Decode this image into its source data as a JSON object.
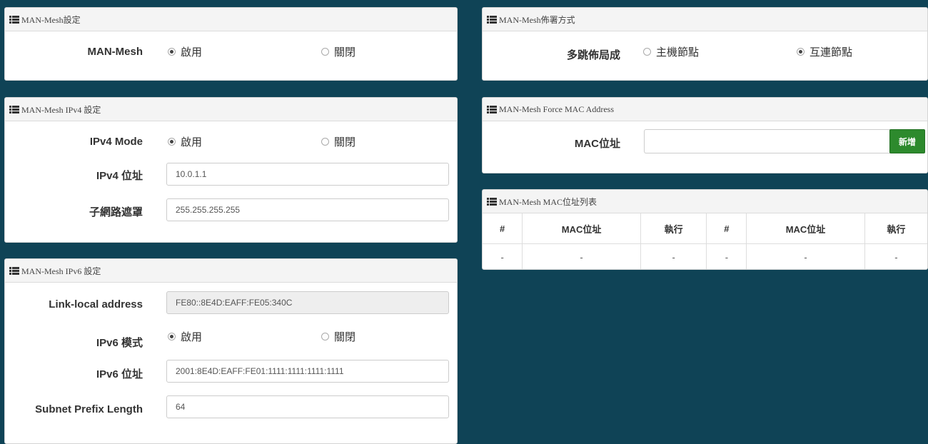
{
  "mesh_settings": {
    "title": "MAN-Mesh設定",
    "label": "MAN-Mesh",
    "options": [
      "啟用",
      "關閉"
    ],
    "selected": "啟用"
  },
  "deploy_mode": {
    "title": "MAN-Mesh佈署方式",
    "label": "多跳佈局成",
    "options": [
      "主機節點",
      "互連節點"
    ],
    "selected": "互連節點"
  },
  "ipv4": {
    "title": "MAN-Mesh IPv4 設定",
    "mode_label": "IPv4 Mode",
    "options": [
      "啟用",
      "關閉"
    ],
    "selected": "啟用",
    "address_label": "IPv4 位址",
    "address_value": "10.0.1.1",
    "netmask_label": "子網路遮罩",
    "netmask_value": "255.255.255.255"
  },
  "force_mac": {
    "title": "MAN-Mesh Force MAC Address",
    "label": "MAC位址",
    "value": "",
    "add_button": "新增"
  },
  "mac_list": {
    "title": "MAN-Mesh MAC位址列表",
    "headers": [
      "#",
      "MAC位址",
      "執行",
      "#",
      "MAC位址",
      "執行"
    ],
    "rows": [
      [
        "-",
        "-",
        "-",
        "-",
        "-",
        "-"
      ]
    ]
  },
  "ipv6": {
    "title": "MAN-Mesh IPv6 設定",
    "link_local_label": "Link-local address",
    "link_local_value": "FE80::8E4D:EAFF:FE05:340C",
    "mode_label": "IPv6 模式",
    "options": [
      "啟用",
      "關閉"
    ],
    "selected": "啟用",
    "address_label": "IPv6 位址",
    "address_value": "2001:8E4D:EAFF:FE01:1111:1111:1111:1111",
    "prefix_label": "Subnet Prefix Length",
    "prefix_value": "64"
  },
  "colors": {
    "background": "#0f4356",
    "add_button": "#2d8a2d"
  },
  "icons": {
    "panel_header": "list-icon"
  }
}
